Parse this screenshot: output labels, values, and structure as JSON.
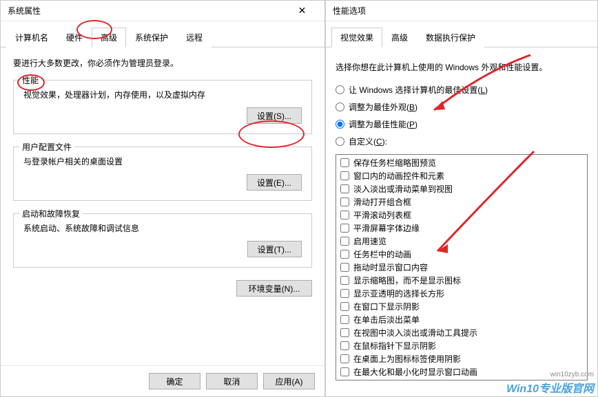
{
  "left_dialog": {
    "title": "系统属性",
    "tabs": [
      "计算机名",
      "硬件",
      "高级",
      "系统保护",
      "远程"
    ],
    "active_tab": 2,
    "admin_notice": "要进行大多数更改，你必须作为管理员登录。",
    "groups": {
      "performance": {
        "title": "性能",
        "desc": "视觉效果，处理器计划，内存使用，以及虚拟内存",
        "button": "设置(S)..."
      },
      "user_profiles": {
        "title": "用户配置文件",
        "desc": "与登录帐户相关的桌面设置",
        "button": "设置(E)..."
      },
      "startup": {
        "title": "启动和故障恢复",
        "desc": "系统启动、系统故障和调试信息",
        "button": "设置(T)..."
      }
    },
    "env_vars_button": "环境变量(N)...",
    "buttons": {
      "ok": "确定",
      "cancel": "取消",
      "apply": "应用(A)"
    }
  },
  "right_dialog": {
    "title": "性能选项",
    "tabs": [
      "视觉效果",
      "高级",
      "数据执行保护"
    ],
    "active_tab": 0,
    "desc": "选择你想在此计算机上使用的 Windows 外观和性能设置。",
    "radios": [
      {
        "label": "让 Windows 选择计算机的最佳设置(L)",
        "key": "L",
        "selected": false
      },
      {
        "label": "调整为最佳外观(B)",
        "key": "B",
        "selected": false
      },
      {
        "label": "调整为最佳性能(P)",
        "key": "P",
        "selected": true
      },
      {
        "label": "自定义(C):",
        "key": "C",
        "selected": false
      }
    ],
    "checkboxes": [
      {
        "label": "保存任务栏缩略图预览",
        "checked": false
      },
      {
        "label": "窗口内的动画控件和元素",
        "checked": false
      },
      {
        "label": "淡入淡出或滑动菜单到视图",
        "checked": false
      },
      {
        "label": "滑动打开组合框",
        "checked": false
      },
      {
        "label": "平滑滚动列表框",
        "checked": false
      },
      {
        "label": "平滑屏幕字体边缘",
        "checked": false
      },
      {
        "label": "启用速览",
        "checked": false
      },
      {
        "label": "任务栏中的动画",
        "checked": false
      },
      {
        "label": "拖动时显示窗口内容",
        "checked": false
      },
      {
        "label": "显示缩略图，而不是显示图标",
        "checked": false
      },
      {
        "label": "显示亚透明的选择长方形",
        "checked": false
      },
      {
        "label": "在窗口下显示阴影",
        "checked": false
      },
      {
        "label": "在单击后淡出菜单",
        "checked": false
      },
      {
        "label": "在视图中淡入淡出或滑动工具提示",
        "checked": false
      },
      {
        "label": "在鼠标指针下显示阴影",
        "checked": false
      },
      {
        "label": "在桌面上为图标标签使用阴影",
        "checked": false
      },
      {
        "label": "在最大化和最小化时显示窗口动画",
        "checked": false
      }
    ]
  },
  "watermark": {
    "url": "win10zyb.com",
    "text": "Win10专业版官网"
  }
}
